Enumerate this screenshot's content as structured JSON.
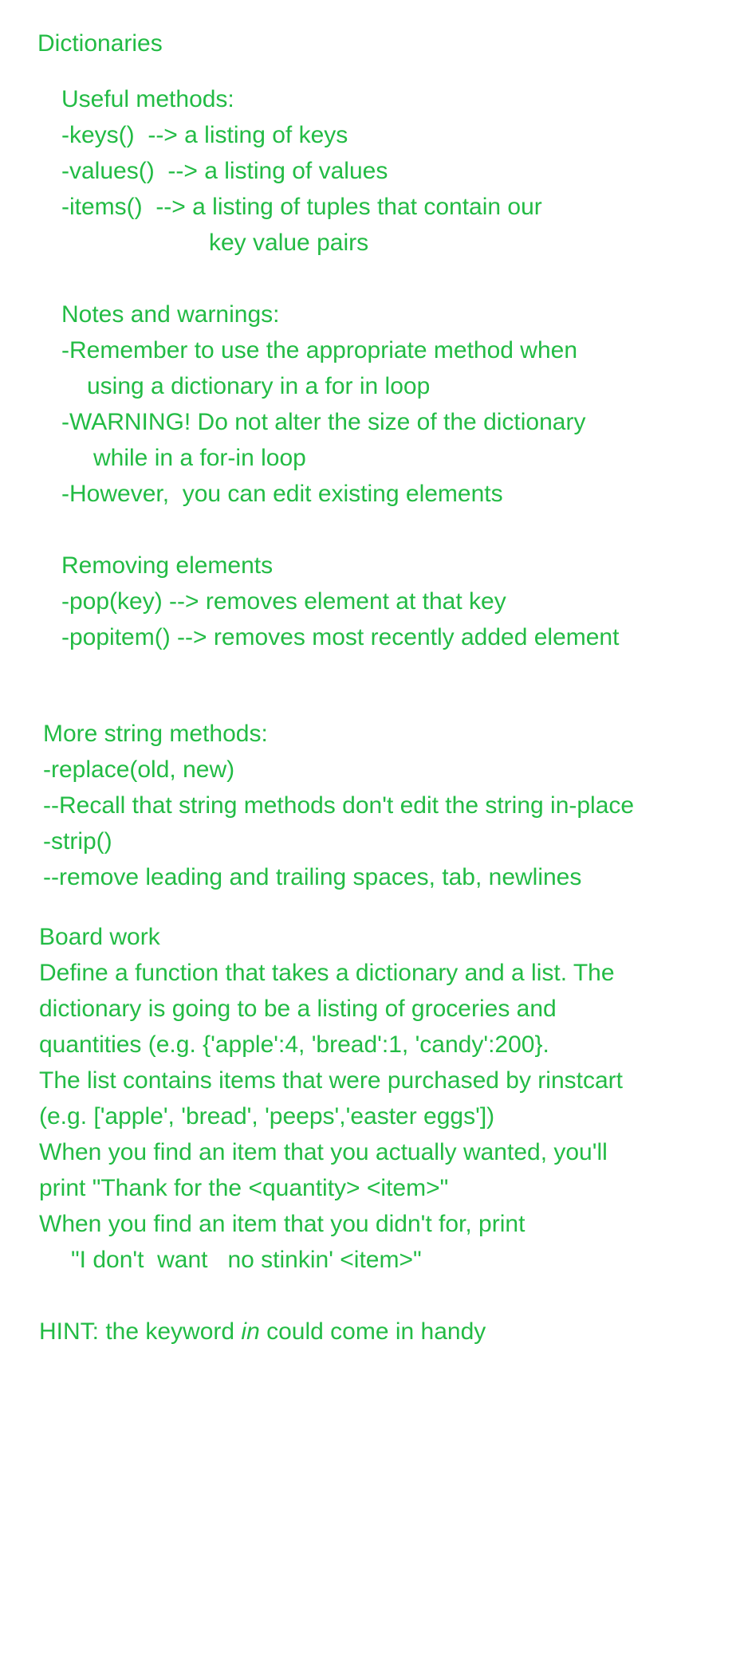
{
  "title": "Dictionaries",
  "dictionaries": {
    "useful_methods_heading": "Useful methods:",
    "keys": "-keys()  --> a listing of keys",
    "values": "-values()  --> a listing of values",
    "items": "-items()  --> a listing of tuples that contain our",
    "items_cont": "key value pairs",
    "notes_heading": "Notes and warnings:",
    "note1": "-Remember to use the appropriate method when",
    "note1_cont": "using a dictionary in a for in loop",
    "note2": "-WARNING! Do not alter the size of the dictionary",
    "note2_cont": "while in a for-in loop",
    "note3": "-However,  you can edit existing elements",
    "removing_heading": "Removing elements",
    "pop": "-pop(key) --> removes element at that key",
    "popitem": "-popitem() --> removes most recently added element"
  },
  "string_methods": {
    "heading": "More string methods:",
    "replace": "-replace(old, new)",
    "replace_note": "--Recall that string methods don't edit the string in-place",
    "strip": "-strip()",
    "strip_note": "--remove leading and trailing spaces, tab, newlines"
  },
  "board_work": {
    "heading": "Board work",
    "lines": [
      "Define a function that takes a dictionary and a list. The",
      "dictionary is going to be a listing of groceries and",
      "quantities (e.g. {'apple':4, 'bread':1, 'candy':200}.",
      "The list contains items that were purchased by rinstcart",
      "(e.g. ['apple', 'bread', 'peeps','easter eggs'])",
      "When you find an item that you actually wanted, you'll",
      "print \"Thank for the <quantity> <item>\"",
      "When you find an item that you didn't for, print",
      "\"I don't  want   no stinkin' <item>\""
    ],
    "hint_prefix": "HINT: the keyword ",
    "hint_keyword": "in",
    "hint_suffix": " could come in handy"
  },
  "colors": {
    "text": "#22bb44",
    "background": "#ffffff"
  }
}
